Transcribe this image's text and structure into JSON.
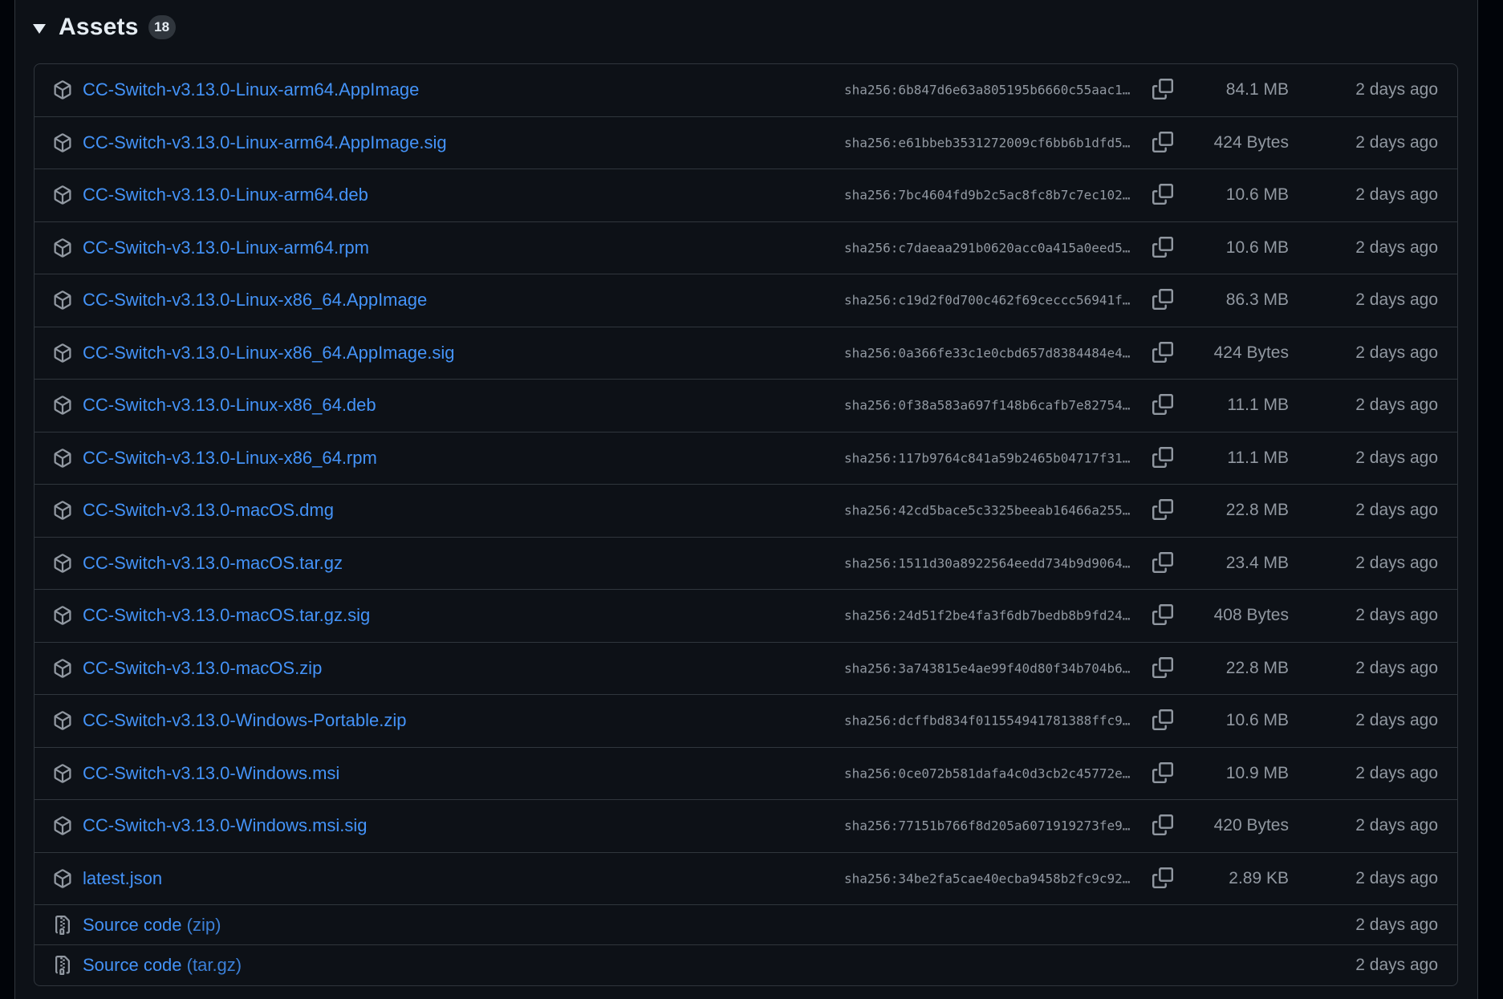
{
  "header": {
    "title": "Assets",
    "count": "18"
  },
  "assets": [
    {
      "name": "CC-Switch-v3.13.0-Linux-arm64.AppImage",
      "sha": "sha256:6b847d6e63a805195b6660c55aac1…",
      "size": "84.1 MB",
      "date": "2 days ago"
    },
    {
      "name": "CC-Switch-v3.13.0-Linux-arm64.AppImage.sig",
      "sha": "sha256:e61bbeb3531272009cf6bb6b1dfd5…",
      "size": "424 Bytes",
      "date": "2 days ago"
    },
    {
      "name": "CC-Switch-v3.13.0-Linux-arm64.deb",
      "sha": "sha256:7bc4604fd9b2c5ac8fc8b7c7ec102…",
      "size": "10.6 MB",
      "date": "2 days ago"
    },
    {
      "name": "CC-Switch-v3.13.0-Linux-arm64.rpm",
      "sha": "sha256:c7daeaa291b0620acc0a415a0eed5…",
      "size": "10.6 MB",
      "date": "2 days ago"
    },
    {
      "name": "CC-Switch-v3.13.0-Linux-x86_64.AppImage",
      "sha": "sha256:c19d2f0d700c462f69ceccc56941f…",
      "size": "86.3 MB",
      "date": "2 days ago"
    },
    {
      "name": "CC-Switch-v3.13.0-Linux-x86_64.AppImage.sig",
      "sha": "sha256:0a366fe33c1e0cbd657d8384484e4…",
      "size": "424 Bytes",
      "date": "2 days ago"
    },
    {
      "name": "CC-Switch-v3.13.0-Linux-x86_64.deb",
      "sha": "sha256:0f38a583a697f148b6cafb7e82754…",
      "size": "11.1 MB",
      "date": "2 days ago"
    },
    {
      "name": "CC-Switch-v3.13.0-Linux-x86_64.rpm",
      "sha": "sha256:117b9764c841a59b2465b04717f31…",
      "size": "11.1 MB",
      "date": "2 days ago"
    },
    {
      "name": "CC-Switch-v3.13.0-macOS.dmg",
      "sha": "sha256:42cd5bace5c3325beeab16466a255…",
      "size": "22.8 MB",
      "date": "2 days ago"
    },
    {
      "name": "CC-Switch-v3.13.0-macOS.tar.gz",
      "sha": "sha256:1511d30a8922564eedd734b9d9064…",
      "size": "23.4 MB",
      "date": "2 days ago"
    },
    {
      "name": "CC-Switch-v3.13.0-macOS.tar.gz.sig",
      "sha": "sha256:24d51f2be4fa3f6db7bedb8b9fd24…",
      "size": "408 Bytes",
      "date": "2 days ago"
    },
    {
      "name": "CC-Switch-v3.13.0-macOS.zip",
      "sha": "sha256:3a743815e4ae99f40d80f34b704b6…",
      "size": "22.8 MB",
      "date": "2 days ago"
    },
    {
      "name": "CC-Switch-v3.13.0-Windows-Portable.zip",
      "sha": "sha256:dcffbd834f011554941781388ffc9…",
      "size": "10.6 MB",
      "date": "2 days ago"
    },
    {
      "name": "CC-Switch-v3.13.0-Windows.msi",
      "sha": "sha256:0ce072b581dafa4c0d3cb2c45772e…",
      "size": "10.9 MB",
      "date": "2 days ago"
    },
    {
      "name": "CC-Switch-v3.13.0-Windows.msi.sig",
      "sha": "sha256:77151b766f8d205a6071919273fe9…",
      "size": "420 Bytes",
      "date": "2 days ago"
    },
    {
      "name": "latest.json",
      "sha": "sha256:34be2fa5cae40ecba9458b2fc9c92…",
      "size": "2.89 KB",
      "date": "2 days ago"
    }
  ],
  "source": [
    {
      "label": "Source code",
      "format": "(zip)",
      "date": "2 days ago"
    },
    {
      "label": "Source code",
      "format": "(tar.gz)",
      "date": "2 days ago"
    }
  ],
  "icons": {
    "package": "package-icon",
    "copy": "copy-icon",
    "zip": "file-zip-icon",
    "caret": "triangle-down-icon"
  },
  "colors": {
    "link": "#4493f8",
    "muted": "#9198a1",
    "border": "#30363d",
    "background": "#0d1117"
  }
}
